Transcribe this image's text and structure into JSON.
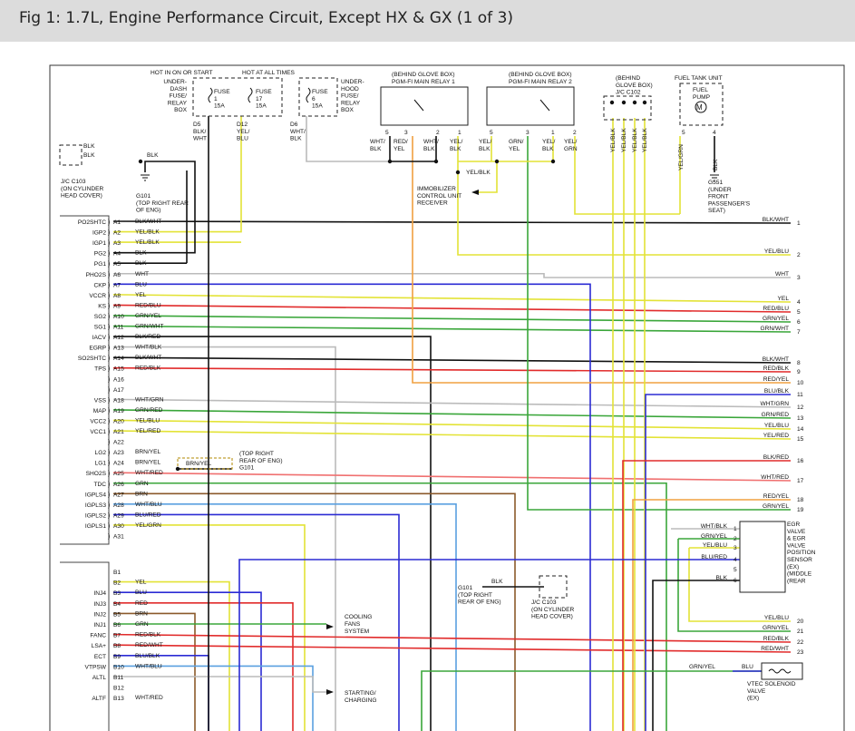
{
  "header": {
    "title": "Fig 1: 1.7L, Engine Performance Circuit, Except HX & GX (1 of 3)"
  },
  "colors": {
    "black": "#111111",
    "yellow": "#e3e336",
    "red": "#e12b2b",
    "blue": "#2b2bd4",
    "green": "#3aa63a",
    "white": "#bbbbbb",
    "brown": "#8b5a2b",
    "orange": "#f0a040",
    "lt_blue": "#5aa0e0",
    "pink": "#f07070",
    "violet": "#7a3aa0"
  },
  "top": {
    "hot_run": "HOT IN ON OR START",
    "hot_all": "HOT AT ALL TIMES",
    "dash_box": [
      "UNDER-",
      "DASH",
      "FUSE/",
      "RELAY",
      "BOX"
    ],
    "hood_box": [
      "UNDER-",
      "HOOD",
      "FUSE/",
      "RELAY",
      "BOX"
    ],
    "fuse1": [
      "FUSE",
      "1",
      "15A"
    ],
    "fuse17": [
      "FUSE",
      "17",
      "15A"
    ],
    "fuse6": [
      "FUSE",
      "6",
      "15A"
    ],
    "d5": [
      "D5",
      "BLK/",
      "WHT"
    ],
    "d12": [
      "D12",
      "YEL/",
      "BLU"
    ],
    "d6": [
      "D6",
      "WHT/",
      "BLK"
    ],
    "relay1": [
      "(BEHIND GLOVE BOX)",
      "PGM-FI MAIN RELAY 1"
    ],
    "relay2": [
      "(BEHIND GLOVE BOX)",
      "PGM-FI MAIN RELAY 2"
    ],
    "jc102": [
      "(BEHIND",
      "GLOVE BOX)",
      "J/C C102"
    ],
    "fuel_unit": "FUEL TANK UNIT",
    "fuel_pump": [
      "FUEL",
      "PUMP"
    ],
    "r1_pins": [
      "5",
      "3",
      "2",
      "1"
    ],
    "r1_wires": [
      [
        "WHT/",
        "BLK"
      ],
      [
        "RED/",
        "YEL"
      ],
      [
        "WHT/",
        "BLK"
      ],
      [
        "YEL/",
        "BLK"
      ]
    ],
    "r2_pins": [
      "5",
      "3",
      "1",
      "2"
    ],
    "r2_wires": [
      [
        "YEL/",
        "BLK"
      ],
      [
        "GRN/",
        "YEL"
      ],
      [
        "YEL/",
        "BLK"
      ],
      [
        "YEL/",
        "GRN"
      ]
    ],
    "jc_wires": [
      "YEL/BLK",
      "YEL/BLK",
      "YEL/BLK",
      "YEL/BLK"
    ],
    "fuel_pins": [
      "5",
      "4"
    ],
    "fuel_wires": [
      "YEL/GRN",
      "BLK"
    ],
    "g551": [
      "G551",
      "(UNDER",
      "FRONT",
      "PASSENGER'S",
      "SEAT)"
    ],
    "imm_wire": "YEL/BLK",
    "imm": [
      "IMMOBILIZER",
      "CONTROL UNIT",
      "RECEIVER"
    ],
    "jc103": [
      "J/C C103",
      "(ON CYLINDER",
      "HEAD COVER)"
    ],
    "jc103_w": [
      "BLK",
      "BLK",
      "BLK"
    ],
    "g101": [
      "G101",
      "(TOP RIGHT REAR",
      "OF ENG)"
    ]
  },
  "a_rows": [
    {
      "pin": "A1",
      "func": "PO2SHTC",
      "wire": "BLK/WHT"
    },
    {
      "pin": "A2",
      "func": "IGP2",
      "wire": "YEL/BLK"
    },
    {
      "pin": "A3",
      "func": "IGP1",
      "wire": "YEL/BLK"
    },
    {
      "pin": "A4",
      "func": "PG2",
      "wire": "BLK"
    },
    {
      "pin": "A5",
      "func": "PG1",
      "wire": "BLK"
    },
    {
      "pin": "A6",
      "func": "PHO2S",
      "wire": "WHT"
    },
    {
      "pin": "A7",
      "func": "CKP",
      "wire": "BLU"
    },
    {
      "pin": "A8",
      "func": "VCCR",
      "wire": "YEL"
    },
    {
      "pin": "A9",
      "func": "KS",
      "wire": "RED/BLU"
    },
    {
      "pin": "A10",
      "func": "SG2",
      "wire": "GRN/YEL"
    },
    {
      "pin": "A11",
      "func": "SG1",
      "wire": "GRN/WHT"
    },
    {
      "pin": "A12",
      "func": "IACV",
      "wire": "BLK/RED"
    },
    {
      "pin": "A13",
      "func": "EGRP",
      "wire": "WHT/BLK"
    },
    {
      "pin": "A14",
      "func": "SO2SHTC",
      "wire": "BLK/WHT"
    },
    {
      "pin": "A15",
      "func": "TPS",
      "wire": "RED/BLK"
    },
    {
      "pin": "A16",
      "func": "",
      "wire": ""
    },
    {
      "pin": "A17",
      "func": "",
      "wire": ""
    },
    {
      "pin": "A18",
      "func": "VSS",
      "wire": "WHT/GRN"
    },
    {
      "pin": "A19",
      "func": "MAP",
      "wire": "GRN/RED"
    },
    {
      "pin": "A20",
      "func": "VCC2",
      "wire": "YEL/BLU"
    },
    {
      "pin": "A21",
      "func": "VCC1",
      "wire": "YEL/RED"
    },
    {
      "pin": "A22",
      "func": "",
      "wire": ""
    },
    {
      "pin": "A23",
      "func": "LG2",
      "wire": "BRN/YEL"
    },
    {
      "pin": "A24",
      "func": "LG1",
      "wire": "BRN/YEL"
    },
    {
      "pin": "A25",
      "func": "SHO2S",
      "wire": "WHT/RED"
    },
    {
      "pin": "A26",
      "func": "TDC",
      "wire": "GRN"
    },
    {
      "pin": "A27",
      "func": "IGPLS4",
      "wire": "BRN"
    },
    {
      "pin": "A28",
      "func": "IGPLS3",
      "wire": "WHT/BLU"
    },
    {
      "pin": "A29",
      "func": "IGPLS2",
      "wire": "BLU/RED"
    },
    {
      "pin": "A30",
      "func": "IGPLS1",
      "wire": "YEL/GRN"
    },
    {
      "pin": "A31",
      "func": "",
      "wire": ""
    }
  ],
  "b_rows": [
    {
      "pin": "B1",
      "func": "",
      "wire": ""
    },
    {
      "pin": "B2",
      "func": "",
      "wire": "YEL"
    },
    {
      "pin": "B3",
      "func": "INJ4",
      "wire": "BLU"
    },
    {
      "pin": "B4",
      "func": "INJ3",
      "wire": "RED"
    },
    {
      "pin": "B5",
      "func": "INJ2",
      "wire": "BRN"
    },
    {
      "pin": "B6",
      "func": "INJ1",
      "wire": "GRN"
    },
    {
      "pin": "B7",
      "func": "FANC",
      "wire": "RED/BLK"
    },
    {
      "pin": "B8",
      "func": "LSA+",
      "wire": "RED/WHT"
    },
    {
      "pin": "B9",
      "func": "ECT",
      "wire": "BLU/BLK"
    },
    {
      "pin": "B10",
      "func": "VTPSW",
      "wire": "WHT/BLU"
    },
    {
      "pin": "B11",
      "func": "ALTL",
      "wire": ""
    },
    {
      "pin": "B12",
      "func": "",
      "wire": ""
    },
    {
      "pin": "B13",
      "func": "ALTF",
      "wire": "WHT/RED"
    }
  ],
  "right": [
    {
      "num": "1",
      "wire": "BLK/WHT"
    },
    {
      "num": "2",
      "wire": "YEL/BLU"
    },
    {
      "num": "3",
      "wire": "WHT"
    },
    {
      "num": "4",
      "wire": "YEL"
    },
    {
      "num": "5",
      "wire": "RED/BLU"
    },
    {
      "num": "6",
      "wire": "GRN/YEL"
    },
    {
      "num": "7",
      "wire": "GRN/WHT"
    },
    {
      "num": "8",
      "wire": "BLK/WHT"
    },
    {
      "num": "9",
      "wire": "RED/BLK"
    },
    {
      "num": "10",
      "wire": "RED/YEL"
    },
    {
      "num": "11",
      "wire": "BLU/BLK"
    },
    {
      "num": "12",
      "wire": "WHT/GRN"
    },
    {
      "num": "13",
      "wire": "GRN/RED"
    },
    {
      "num": "14",
      "wire": "YEL/BLU"
    },
    {
      "num": "15",
      "wire": "YEL/RED"
    },
    {
      "num": "16",
      "wire": "BLK/RED"
    },
    {
      "num": "17",
      "wire": "WHT/RED"
    },
    {
      "num": "18",
      "wire": "RED/YEL"
    },
    {
      "num": "19",
      "wire": "GRN/YEL"
    },
    {
      "num": "20",
      "wire": "YEL/BLU"
    },
    {
      "num": "21",
      "wire": "GRN/YEL"
    },
    {
      "num": "22",
      "wire": "RED/BLK"
    },
    {
      "num": "23",
      "wire": "RED/WHT"
    }
  ],
  "lg": {
    "wire": "BRN/YEL",
    "ref": [
      "(TOP RIGHT",
      "REAR OF ENG)",
      "G101"
    ]
  },
  "egr": {
    "title": [
      "EGR",
      "VALVE",
      "& EGR",
      "VALVE",
      "POSITION",
      "SENSOR",
      "(EX)",
      "(MIDDLE",
      "(REAR"
    ],
    "pins": [
      {
        "wire": "WHT/BLK",
        "num": "1"
      },
      {
        "wire": "GRN/YEL",
        "num": "2"
      },
      {
        "wire": "YEL/BLU",
        "num": "3"
      },
      {
        "wire": "BLU/RED",
        "num": "4"
      },
      {
        "wire": "",
        "num": "5"
      },
      {
        "wire": "BLK",
        "num": "6"
      }
    ]
  },
  "g101b": {
    "wire": "BLK",
    "label": [
      "G101",
      "(TOP RIGHT",
      "REAR OF ENG)"
    ]
  },
  "jc103b": [
    "J/C C103",
    "(ON CYLINDER",
    "HEAD COVER)"
  ],
  "fans": [
    "COOLING",
    "FANS",
    "SYSTEM"
  ],
  "charging": [
    "STARTING/",
    "CHARGING"
  ],
  "vtec": {
    "wire1": "GRN/YEL",
    "wire2": "BLU",
    "label": [
      "VTEC SOLENOID",
      "VALVE",
      "(EX)"
    ]
  }
}
